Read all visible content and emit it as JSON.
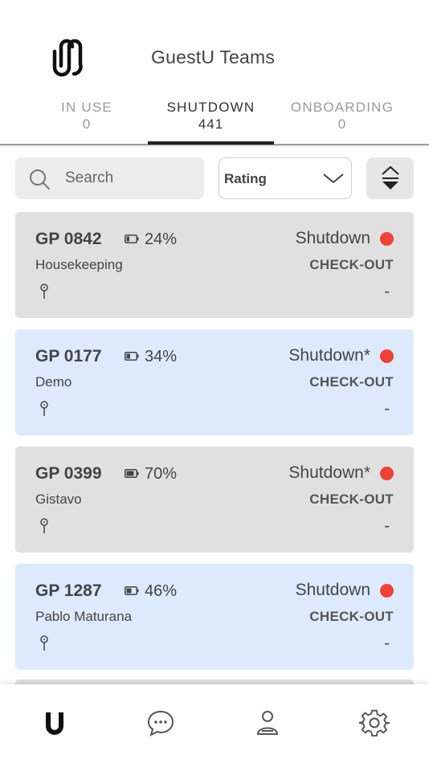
{
  "app": {
    "title": "GuestU Teams"
  },
  "tabs": [
    {
      "label": "IN USE",
      "count": "0"
    },
    {
      "label": "SHUTDOWN",
      "count": "441"
    },
    {
      "label": "ONBOARDING",
      "count": "0"
    }
  ],
  "active_tab": "SHUTDOWN",
  "search": {
    "placeholder": "Search"
  },
  "filter": {
    "selected": "Rating"
  },
  "colors": {
    "gray_card": "#e0e0e0",
    "blue_card": "#ddeafd",
    "status_red": "#ef4136",
    "accent": "#222222"
  },
  "cards": [
    {
      "id": "GP 0842",
      "battery": "24%",
      "label": "Housekeeping",
      "status": "Shutdown",
      "checkout": "CHECK-OUT",
      "detail": "-",
      "style": "gray"
    },
    {
      "id": "GP 0177",
      "battery": "34%",
      "label": "Demo",
      "status": "Shutdown*",
      "checkout": "CHECK-OUT",
      "detail": "-",
      "style": "blue"
    },
    {
      "id": "GP 0399",
      "battery": "70%",
      "label": "Gistavo",
      "status": "Shutdown*",
      "checkout": "CHECK-OUT",
      "detail": "-",
      "style": "gray"
    },
    {
      "id": "GP 1287",
      "battery": "46%",
      "label": "Pablo Maturana",
      "status": "Shutdown",
      "checkout": "CHECK-OUT",
      "detail": "-",
      "style": "blue"
    }
  ],
  "bottom_nav": [
    {
      "icon": "home-u-icon"
    },
    {
      "icon": "chat-icon"
    },
    {
      "icon": "profile-icon"
    },
    {
      "icon": "gear-icon"
    }
  ]
}
